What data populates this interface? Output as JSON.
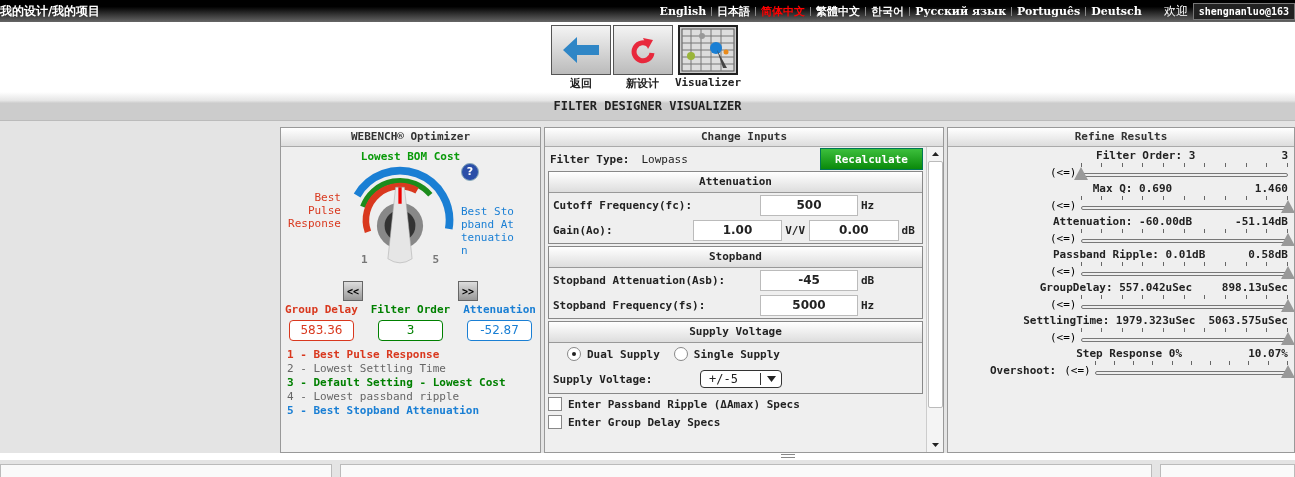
{
  "topbar": {
    "breadcrumb": "我的设计/我的项目",
    "languages": [
      {
        "label": "English",
        "selected": false
      },
      {
        "label": "日本語",
        "selected": false
      },
      {
        "label": "简体中文",
        "selected": true
      },
      {
        "label": "繁體中文",
        "selected": false
      },
      {
        "label": "한국어",
        "selected": false
      },
      {
        "label": "Русский язык",
        "selected": false
      },
      {
        "label": "Português",
        "selected": false
      },
      {
        "label": "Deutsch",
        "selected": false
      }
    ],
    "welcome": "欢迎",
    "user": "shengnanluo@163"
  },
  "toolbar": [
    {
      "kind": "back",
      "label": "返回"
    },
    {
      "kind": "new",
      "label": "新设计"
    },
    {
      "kind": "visualizer",
      "label": "Visualizer"
    }
  ],
  "page_title": "FILTER DESIGNER VISUALIZER",
  "optimizer": {
    "title": "WEBENCH® Optimizer",
    "top_label": "Lowest BOM Cost",
    "left_label": "Best Pulse Response",
    "right_label": "Best Stopband Attenuation",
    "help": "?",
    "dial_min": "1",
    "dial_max": "5",
    "prev": "<<",
    "next": ">>",
    "metrics": [
      {
        "label": "Group Delay",
        "value": "583.36",
        "color": "#d9381e"
      },
      {
        "label": "Filter Order",
        "value": "3",
        "color": "#008000"
      },
      {
        "label": "Attenuation",
        "value": "-52.87",
        "color": "#1a7fd4"
      }
    ],
    "legend": [
      {
        "text": "1 - Best Pulse Response",
        "color": "#d9381e"
      },
      {
        "text": "2 - Lowest Settling Time",
        "color": "#666666"
      },
      {
        "text": "3 - Default Setting - Lowest Cost",
        "color": "#008000"
      },
      {
        "text": "4 - Lowest passband ripple",
        "color": "#666666"
      },
      {
        "text": "5 - Best Stopband Attenuation",
        "color": "#1a7fd4"
      }
    ]
  },
  "inputs": {
    "title": "Change Inputs",
    "filter_type_label": "Filter Type:",
    "filter_type": "Lowpass",
    "recalculate": "Recalculate",
    "attenuation": {
      "title": "Attenuation",
      "cutoff_label": "Cutoff Frequency(fc):",
      "cutoff": "500",
      "cutoff_unit": "Hz",
      "gain_label": "Gain(Ao):",
      "gain_vv": "1.00",
      "vv_unit": "V/V",
      "gain_db": "0.00",
      "db_unit": "dB"
    },
    "stopband": {
      "title": "Stopband",
      "rows": [
        {
          "label": "Stopband Attenuation(Asb):",
          "value": "-45",
          "unit": "dB"
        },
        {
          "label": "Stopband Frequency(fs):",
          "value": "5000",
          "unit": "Hz"
        }
      ]
    },
    "supply": {
      "title": "Supply Voltage",
      "options": [
        {
          "label": "Dual Supply",
          "selected": true
        },
        {
          "label": "Single Supply",
          "selected": false
        }
      ],
      "voltage_label": "Supply Voltage:",
      "voltage": "+/-5"
    },
    "checks": [
      {
        "label": "Enter Passband Ripple (ΔAmax) Specs",
        "checked": false
      },
      {
        "label": "Enter Group Delay Specs",
        "checked": false
      }
    ]
  },
  "refine": {
    "title": "Refine Results",
    "sliders": [
      {
        "label": "Filter Order: 3",
        "max": "3",
        "button": "(<=)",
        "level": 0
      },
      {
        "label": "Max Q: 0.690",
        "max": "1.460",
        "button": "(<=)",
        "level": 1
      },
      {
        "label": "Attenuation: -60.00dB",
        "max": "-51.14dB",
        "button": "(<=)",
        "level": 1
      },
      {
        "label": "Passband Ripple: 0.01dB",
        "max": "0.58dB",
        "button": "(<=)",
        "level": 1
      },
      {
        "label": "GroupDelay: 557.042uSec",
        "max": "898.13uSec",
        "button": "(<=)",
        "level": 1
      },
      {
        "label": "SettlingTime: 1979.323uSec",
        "max": "5063.575uSec",
        "button": "(<=)",
        "level": 1
      },
      {
        "label": "Step Response 0%",
        "max": "10.07%",
        "button": "(<=)",
        "level": 1,
        "sub_label": "Overshoot:"
      }
    ]
  }
}
